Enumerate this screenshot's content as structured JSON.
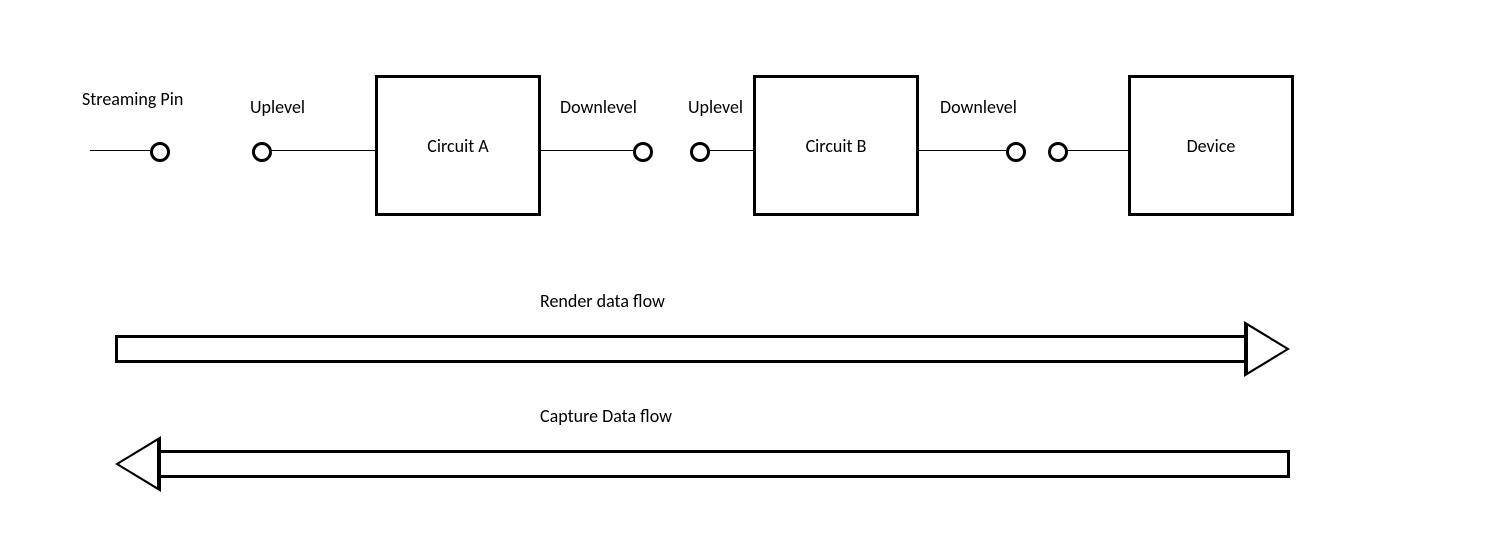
{
  "labels": {
    "streaming_pin": "Streaming Pin",
    "uplevel_1": "Uplevel",
    "downlevel_1": "Downlevel",
    "uplevel_2": "Uplevel",
    "downlevel_2": "Downlevel",
    "render_flow": "Render data flow",
    "capture_flow": "Capture Data flow"
  },
  "boxes": {
    "circuit_a": "Circuit A",
    "circuit_b": "Circuit B",
    "device": "Device"
  }
}
